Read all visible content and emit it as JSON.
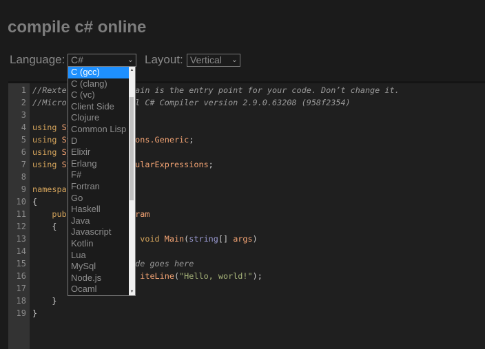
{
  "header": {
    "title": "compile c# online"
  },
  "controls": {
    "language_label": "Language:",
    "language_value": "C#",
    "layout_label": "Layout:",
    "layout_value": "Vertical"
  },
  "language_dropdown": {
    "selected": "C (gcc)",
    "options": [
      "C (gcc)",
      "C (clang)",
      "C (vc)",
      "Client Side",
      "Clojure",
      "Common Lisp",
      "D",
      "Elixir",
      "Erlang",
      "F#",
      "Fortran",
      "Go",
      "Haskell",
      "Java",
      "Javascript",
      "Kotlin",
      "Lua",
      "MySql",
      "Node.js",
      "Ocaml"
    ]
  },
  "editor": {
    "line_numbers": [
      "1",
      "2",
      "3",
      "4",
      "5",
      "6",
      "7",
      "8",
      "9",
      "10",
      "11",
      "12",
      "13",
      "14",
      "15",
      "16",
      "17",
      "18",
      "19"
    ],
    "lines": {
      "l1a": "//Rexte",
      "l1b": "ain is the entry point for your code. Don’t change it.",
      "l2a": "//Micro",
      "l2b": "l C# Compiler version 2.9.0.63208 (958f2354)",
      "l4a": "using",
      "l4b": "Sy",
      "l5a": "using",
      "l5b": "Sy",
      "l5c": "ons.Generic",
      "l6a": "using",
      "l6b": "Sy",
      "l7a": "using",
      "l7b": "Sy",
      "l7c": "ularExpressions",
      "l9a": "namespa",
      "l10": "{",
      "l11a": "publ",
      "l11b": "ram",
      "l12": "{",
      "l13a": "void",
      "l13b": "Main",
      "l13c": "string",
      "l13d": "args",
      "l15": "de goes here",
      "l16a": "iteLine",
      "l16b": "\"Hello, world!\"",
      "l18": "}",
      "l19": "}"
    }
  },
  "colors": {
    "selected_option": "#1e90ff",
    "keyword": "#d6a55c",
    "identifier": "#f4a474",
    "type": "#9b9bd4",
    "string": "#a8b57a"
  }
}
